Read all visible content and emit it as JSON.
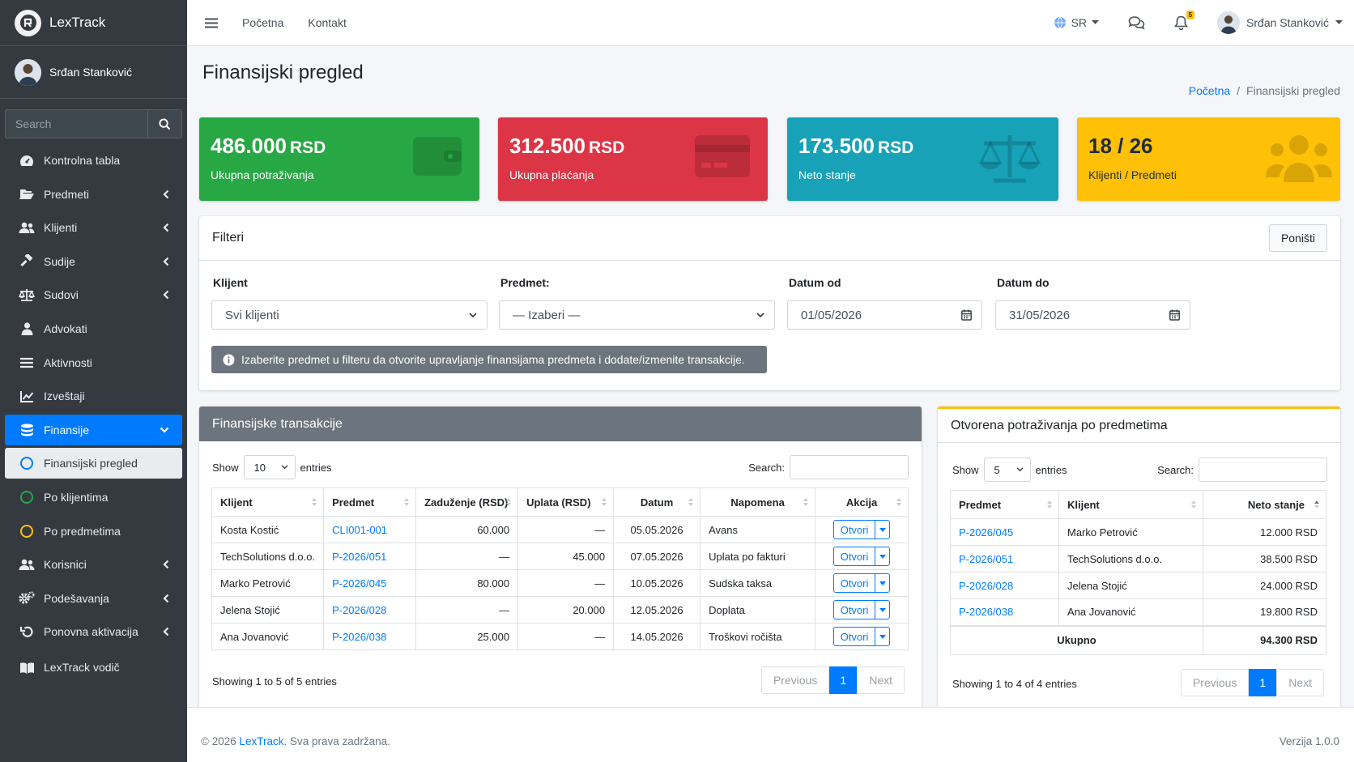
{
  "app": {
    "name": "LexTrack"
  },
  "user": {
    "name": "Srđan Stanković"
  },
  "sidebar": {
    "search_placeholder": "Search",
    "items": [
      {
        "label": "Kontrolna tabla"
      },
      {
        "label": "Predmeti"
      },
      {
        "label": "Klijenti"
      },
      {
        "label": "Sudije"
      },
      {
        "label": "Sudovi"
      },
      {
        "label": "Advokati"
      },
      {
        "label": "Aktivnosti"
      },
      {
        "label": "Izveštaji"
      },
      {
        "label": "Finansije"
      },
      {
        "label": "Finansijski pregled"
      },
      {
        "label": "Po klijentima"
      },
      {
        "label": "Po predmetima"
      },
      {
        "label": "Korisnici"
      },
      {
        "label": "Podešavanja"
      },
      {
        "label": "Ponovna aktivacija"
      },
      {
        "label": "LexTrack vodič"
      }
    ]
  },
  "topbar": {
    "links": [
      "Početna",
      "Kontakt"
    ],
    "lang": "SR",
    "notif_count": "5"
  },
  "page": {
    "title": "Finansijski pregled",
    "breadcrumb": [
      "Početna",
      "/",
      "Finansijski pregled"
    ]
  },
  "stats": [
    {
      "value": "486.000",
      "unit": "RSD",
      "label": "Ukupna potraživanja",
      "color": "#28a745"
    },
    {
      "value": "312.500",
      "unit": "RSD",
      "label": "Ukupna plaćanja",
      "color": "#dc3545"
    },
    {
      "value": "173.500",
      "unit": "RSD",
      "label": "Neto stanje",
      "color": "#17a2b8"
    },
    {
      "value": "18 / 26",
      "unit": "",
      "label": "Klijenti / Predmeti",
      "color": "#ffc107"
    }
  ],
  "filters": {
    "title": "Filteri",
    "reset": "Poništi",
    "client_label": "Klijent",
    "client_value": "Svi klijenti",
    "case_label": "Predmet:",
    "case_value": "— Izaberi —",
    "from_label": "Datum od",
    "from_value": "01/05/2026",
    "to_label": "Datum do",
    "to_value": "31/05/2026",
    "info": "Izaberite predmet u filteru da otvorite upravljanje finansijama predmeta i dodate/izmenite transakcije."
  },
  "transactions": {
    "title": "Finansijske transakcije",
    "show": "Show",
    "entries": "entries",
    "page_size": "10",
    "search": "Search:",
    "columns": [
      "Klijent",
      "Predmet",
      "Zaduženje (RSD)",
      "Uplata (RSD)",
      "Datum",
      "Napomena",
      "Akcija"
    ],
    "rows": [
      [
        "Kosta Kostić",
        "CLI001-001",
        "60.000",
        "—",
        "05.05.2026",
        "Avans",
        "Otvori"
      ],
      [
        "TechSolutions d.o.o.",
        "P-2026/051",
        "—",
        "45.000",
        "07.05.2026",
        "Uplata po fakturi",
        "Otvori"
      ],
      [
        "Marko Petrović",
        "P-2026/045",
        "80.000",
        "—",
        "10.05.2026",
        "Sudska taksa",
        "Otvori"
      ],
      [
        "Jelena Stojić",
        "P-2026/028",
        "—",
        "20.000",
        "12.05.2026",
        "Doplata",
        "Otvori"
      ],
      [
        "Ana Jovanović",
        "P-2026/038",
        "25.000",
        "—",
        "14.05.2026",
        "Troškovi ročišta",
        "Otvori"
      ]
    ],
    "showing": "Showing 1 to 5 of 5 entries",
    "prev": "Previous",
    "page": "1",
    "next": "Next"
  },
  "receivables": {
    "title": "Otvorena potraživanja po predmetima",
    "show": "Show",
    "entries": "entries",
    "page_size": "5",
    "search": "Search:",
    "columns": [
      "Predmet",
      "Klijent",
      "Neto stanje"
    ],
    "rows": [
      [
        "P-2026/045",
        "Marko Petrović",
        "12.000 RSD"
      ],
      [
        "P-2026/051",
        "TechSolutions d.o.o.",
        "38.500 RSD"
      ],
      [
        "P-2026/028",
        "Jelena Stojić",
        "24.000 RSD"
      ],
      [
        "P-2026/038",
        "Ana Jovanović",
        "19.800 RSD"
      ]
    ],
    "total_label": "Ukupno",
    "total_value": "94.300 RSD",
    "showing": "Showing 1 to 4 of 4 entries",
    "prev": "Previous",
    "page": "1",
    "next": "Next"
  },
  "footer": {
    "copy_prefix": "© 2026",
    "brand": "LexTrack",
    "copy_suffix": ". Sva prava zadržana.",
    "version": "Verzija 1.0.0"
  }
}
